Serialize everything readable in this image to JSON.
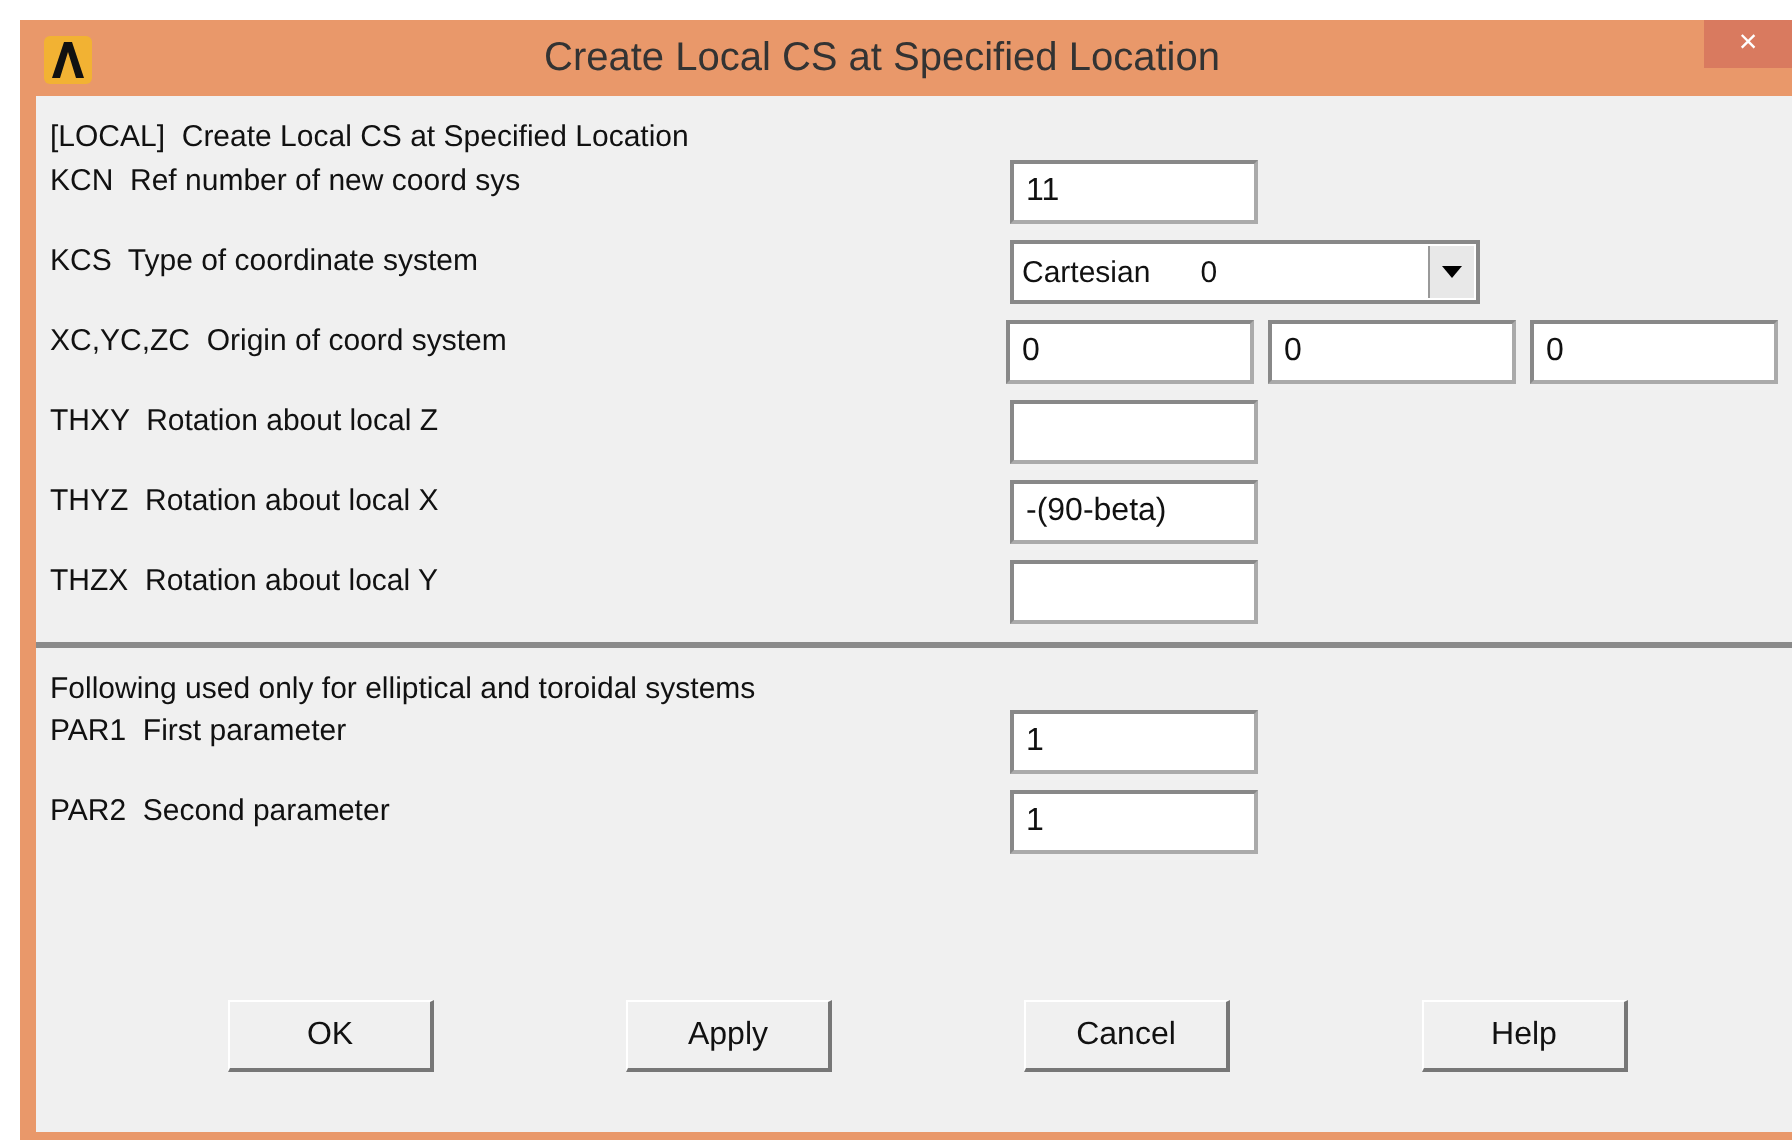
{
  "window": {
    "title": "Create Local CS at Specified Location",
    "close": "×"
  },
  "heading": "[LOCAL]  Create Local CS at Specified Location",
  "fields": [
    {
      "kind": "text",
      "label": "KCN  Ref number of new coord sys",
      "value": "11"
    },
    {
      "kind": "dropdown",
      "label": "KCS  Type of coordinate system",
      "value": "Cartesian      0"
    },
    {
      "kind": "triple",
      "label": "XC,YC,ZC  Origin of coord system",
      "values": [
        "0",
        "0",
        "0"
      ]
    },
    {
      "kind": "text",
      "label": "THXY  Rotation about local Z"
    },
    {
      "kind": "text",
      "label": "THYZ  Rotation about local X",
      "value": "-(90-beta)"
    },
    {
      "kind": "text",
      "label": "THZX  Rotation about local Y"
    }
  ],
  "section2": {
    "heading": "Following used only for elliptical and toroidal systems",
    "fields": [
      {
        "kind": "text",
        "label": "PAR1  First parameter",
        "value": "1"
      },
      {
        "kind": "text",
        "label": "PAR2  Second parameter",
        "value": "1"
      }
    ]
  },
  "buttons": [
    "OK",
    "Apply",
    "Cancel",
    "Help"
  ]
}
